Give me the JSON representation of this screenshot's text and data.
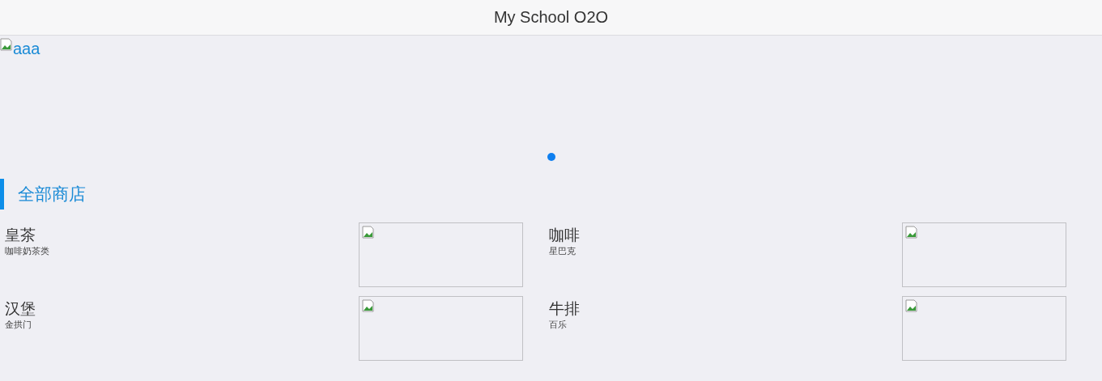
{
  "header": {
    "title": "My School O2O"
  },
  "banner": {
    "image_alt": "aaa",
    "dots": [
      {
        "selected": true
      }
    ]
  },
  "section": {
    "title": "全部商店"
  },
  "shops": [
    {
      "name": "皇茶",
      "description": "咖啡奶茶类"
    },
    {
      "name": "咖啡",
      "description": "星巴克"
    },
    {
      "name": "汉堡",
      "description": "金拱门"
    },
    {
      "name": "牛排",
      "description": "百乐"
    }
  ]
}
